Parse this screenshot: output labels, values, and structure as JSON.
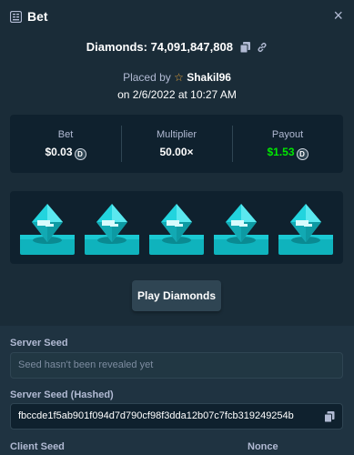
{
  "header": {
    "title": "Bet",
    "close_label": "×"
  },
  "game": {
    "title": "Diamonds: 74,091,847,808"
  },
  "placed": {
    "prefix": "Placed by",
    "user": "Shakil96",
    "date": "on 2/6/2022 at 10:27 AM"
  },
  "stats": {
    "bet_label": "Bet",
    "bet_value": "$0.03",
    "multiplier_label": "Multiplier",
    "multiplier_value": "50.00×",
    "payout_label": "Payout",
    "payout_value": "$1.53",
    "currency_symbol": "D"
  },
  "gems": {
    "count": 5,
    "color": "#22d4de"
  },
  "play_button": {
    "label": "Play Diamonds"
  },
  "server_seed": {
    "label": "Server Seed",
    "placeholder": "Seed hasn't been revealed yet"
  },
  "server_seed_hashed": {
    "label": "Server Seed (Hashed)",
    "value": "fbccde1f5ab901f094d7d790cf98f3dda12b07c7fcb319249254b"
  },
  "client_seed": {
    "label": "Client Seed"
  },
  "nonce": {
    "label": "Nonce"
  },
  "colors": {
    "background": "#1a2c38",
    "panel": "#0f212e",
    "accent_green": "#00e701",
    "gem": "#22d4de"
  }
}
